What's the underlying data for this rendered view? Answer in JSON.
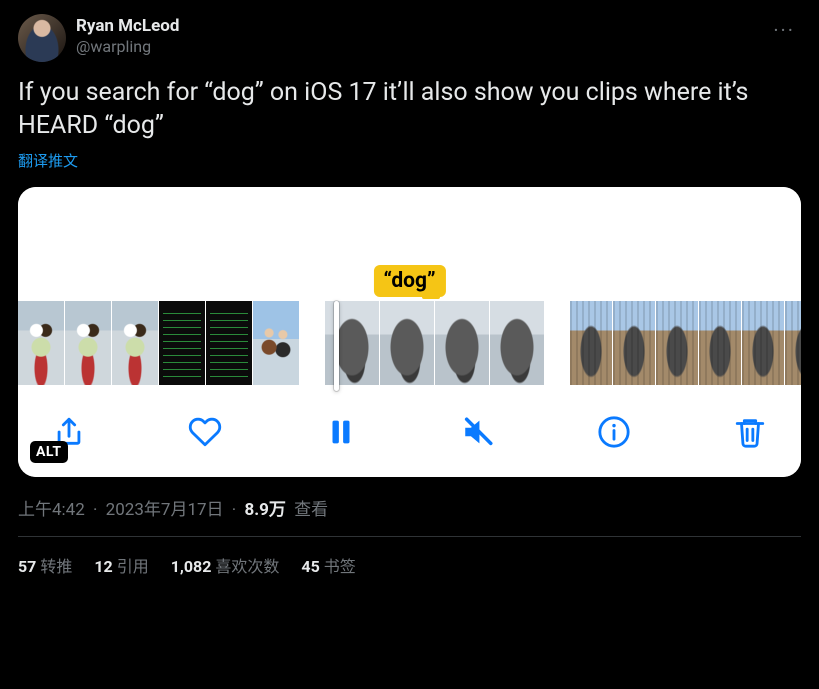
{
  "author": {
    "display_name": "Ryan McLeod",
    "handle": "@warpling"
  },
  "more_glyph": "···",
  "tweet_text": "If you search for “dog” on iOS 17 it’ll also show you clips where it’s HEARD “dog”",
  "translate_label": "翻译推文",
  "media": {
    "search_chip": "“dog”",
    "alt_badge": "ALT",
    "toolbar_icons": {
      "share": "share-icon",
      "heart": "heart-icon",
      "pause": "pause-icon",
      "mute": "mute-icon",
      "info": "info-icon",
      "trash": "trash-icon"
    }
  },
  "meta": {
    "time": "上午4:42",
    "date": "2023年7月17日",
    "views_value": "8.9万",
    "views_label": "查看"
  },
  "stats": {
    "retweets": {
      "count": "57",
      "label": "转推"
    },
    "quotes": {
      "count": "12",
      "label": "引用"
    },
    "likes": {
      "count": "1,082",
      "label": "喜欢次数"
    },
    "bookmarks": {
      "count": "45",
      "label": "书签"
    }
  }
}
